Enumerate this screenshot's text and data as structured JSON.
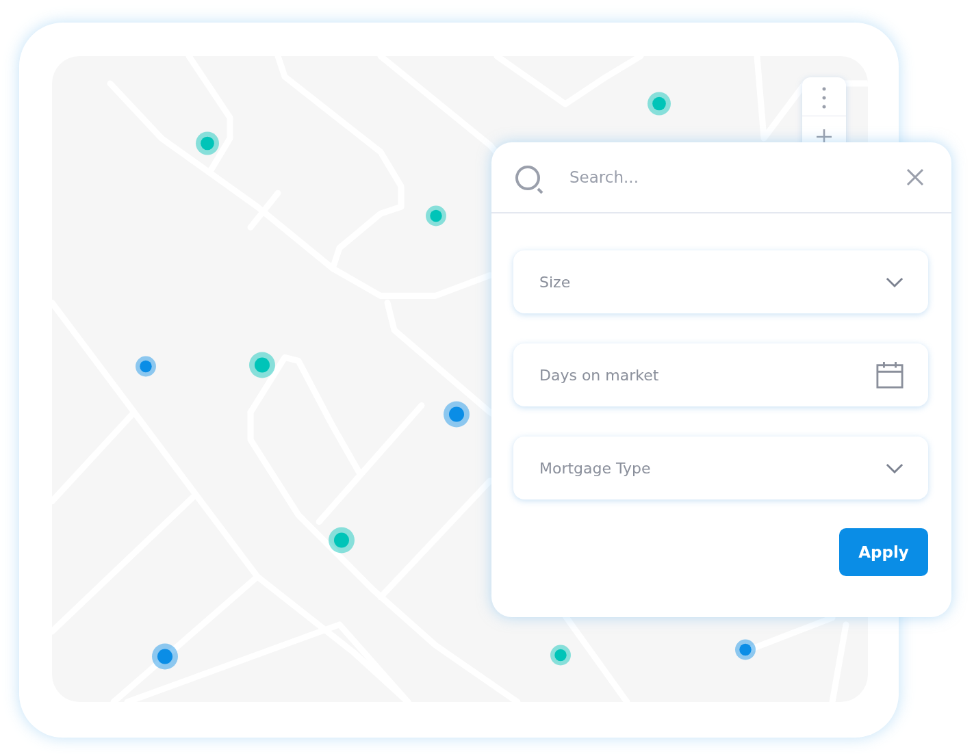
{
  "map": {
    "pins": [
      {
        "color": "#00c4b8"
      },
      {
        "color": "#00c4b8"
      },
      {
        "color": "#00c4b8"
      },
      {
        "color": "#00c4b8"
      },
      {
        "color": "#00c4b8"
      },
      {
        "color": "#00c4b8"
      },
      {
        "color": "#0a8de6"
      },
      {
        "color": "#0a8de6"
      },
      {
        "color": "#0a8de6"
      },
      {
        "color": "#0a8de6"
      }
    ]
  },
  "search": {
    "placeholder": "Search..."
  },
  "filters": [
    {
      "kind": "dropdown",
      "placeholder": "Size"
    },
    {
      "kind": "date",
      "placeholder": "Days on market"
    },
    {
      "kind": "dropdown",
      "placeholder": "Mortgage Type"
    }
  ],
  "apply_button": "Apply"
}
